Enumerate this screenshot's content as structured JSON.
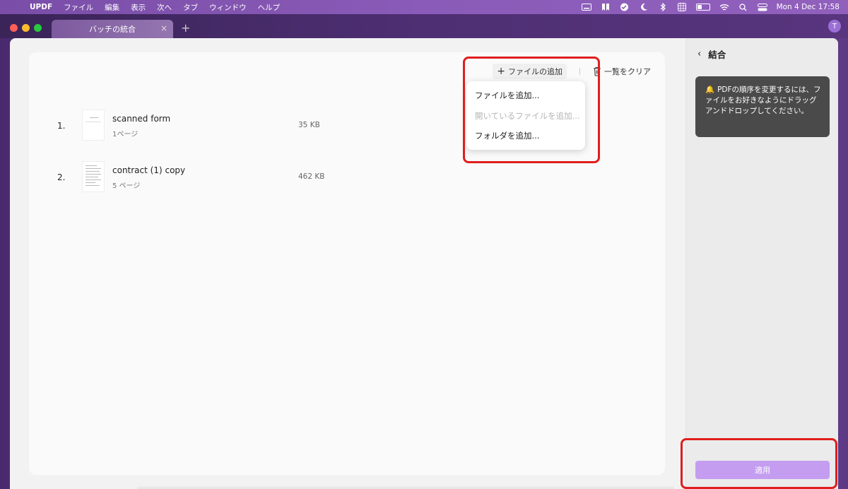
{
  "menubar": {
    "app_name": "UPDF",
    "items": [
      "ファイル",
      "編集",
      "表示",
      "次へ",
      "タブ",
      "ウィンドウ",
      "ヘルプ"
    ],
    "clock": "Mon 4 Dec  17:58"
  },
  "window": {
    "tab_title": "バッチの統合",
    "avatar_initial": "T"
  },
  "toolbar": {
    "add_file_label": "ファイルの追加",
    "clear_label": "一覧をクリア"
  },
  "dropdown": {
    "items": [
      {
        "label": "ファイルを追加...",
        "enabled": true
      },
      {
        "label": "開いているファイルを追加...",
        "enabled": false
      },
      {
        "label": "フォルダを追加...",
        "enabled": true
      }
    ]
  },
  "files": [
    {
      "index": "1.",
      "name": "scanned form",
      "pages": "1ページ",
      "size": "35 KB"
    },
    {
      "index": "2.",
      "name": "contract (1) copy",
      "pages": "5 ページ",
      "size": "462 KB"
    }
  ],
  "side_panel": {
    "title": "結合",
    "tip": "PDFの順序を変更するには、ファイルをお好きなようにドラッグアンドドロップしてください。",
    "apply_label": "適用"
  },
  "colors": {
    "accent": "#c49df0",
    "highlight": "#e01e1e"
  }
}
